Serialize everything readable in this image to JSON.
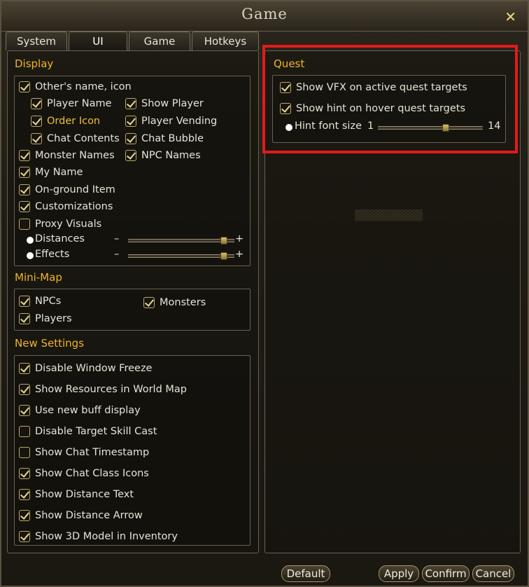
{
  "window": {
    "title": "Game"
  },
  "tabs": [
    {
      "label": "System"
    },
    {
      "label": "UI"
    },
    {
      "label": "Game"
    },
    {
      "label": "Hotkeys"
    }
  ],
  "display": {
    "title": "Display",
    "items": [
      {
        "label": "Other's name, icon",
        "checked": true
      },
      {
        "label": "Player Name",
        "checked": true
      },
      {
        "label": "Show Player",
        "checked": true
      },
      {
        "label": "Order Icon",
        "checked": true
      },
      {
        "label": "Player Vending",
        "checked": true
      },
      {
        "label": "Chat Contents",
        "checked": true
      },
      {
        "label": "Chat Bubble",
        "checked": true
      },
      {
        "label": "Monster Names",
        "checked": true
      },
      {
        "label": "NPC Names",
        "checked": true
      },
      {
        "label": "My Name",
        "checked": true
      },
      {
        "label": "On-ground Item",
        "checked": true
      },
      {
        "label": "Customizations",
        "checked": true
      },
      {
        "label": "Proxy Visuals",
        "checked": false
      }
    ],
    "sliders": [
      {
        "label": "Distances",
        "minus": "–",
        "plus": "+",
        "level": 0.93
      },
      {
        "label": "Effects",
        "minus": "–",
        "plus": "+",
        "level": 0.93
      }
    ]
  },
  "minimap": {
    "title": "Mini-Map",
    "items": [
      {
        "label": "NPCs",
        "checked": true
      },
      {
        "label": "Monsters",
        "checked": true
      },
      {
        "label": "Players",
        "checked": true
      }
    ]
  },
  "new_settings": {
    "title": "New Settings",
    "items": [
      {
        "label": "Disable Window Freeze",
        "checked": true
      },
      {
        "label": "Show Resources in World Map",
        "checked": true
      },
      {
        "label": "Use new buff display",
        "checked": true
      },
      {
        "label": "Disable Target Skill Cast",
        "checked": false
      },
      {
        "label": "Show Chat Timestamp",
        "checked": false
      },
      {
        "label": "Show Chat Class Icons",
        "checked": true
      },
      {
        "label": "Show Distance Text",
        "checked": true
      },
      {
        "label": "Show Distance Arrow",
        "checked": true
      },
      {
        "label": "Show 3D Model in Inventory",
        "checked": true
      }
    ]
  },
  "quest": {
    "title": "Quest",
    "items": [
      {
        "label": "Show VFX on active quest targets",
        "checked": true
      },
      {
        "label": "Show hint on hover quest targets",
        "checked": true
      }
    ],
    "hint_font_size": {
      "label": "Hint font size",
      "min": "1",
      "max": "14",
      "level": 0.66
    }
  },
  "buttons": {
    "default": "Default",
    "apply": "Apply",
    "confirm": "Confirm",
    "cancel": "Cancel"
  },
  "colors": {
    "section_title": "#f0b429",
    "highlight_border": "#e11b1b",
    "gold_label": "#e9c23a"
  }
}
